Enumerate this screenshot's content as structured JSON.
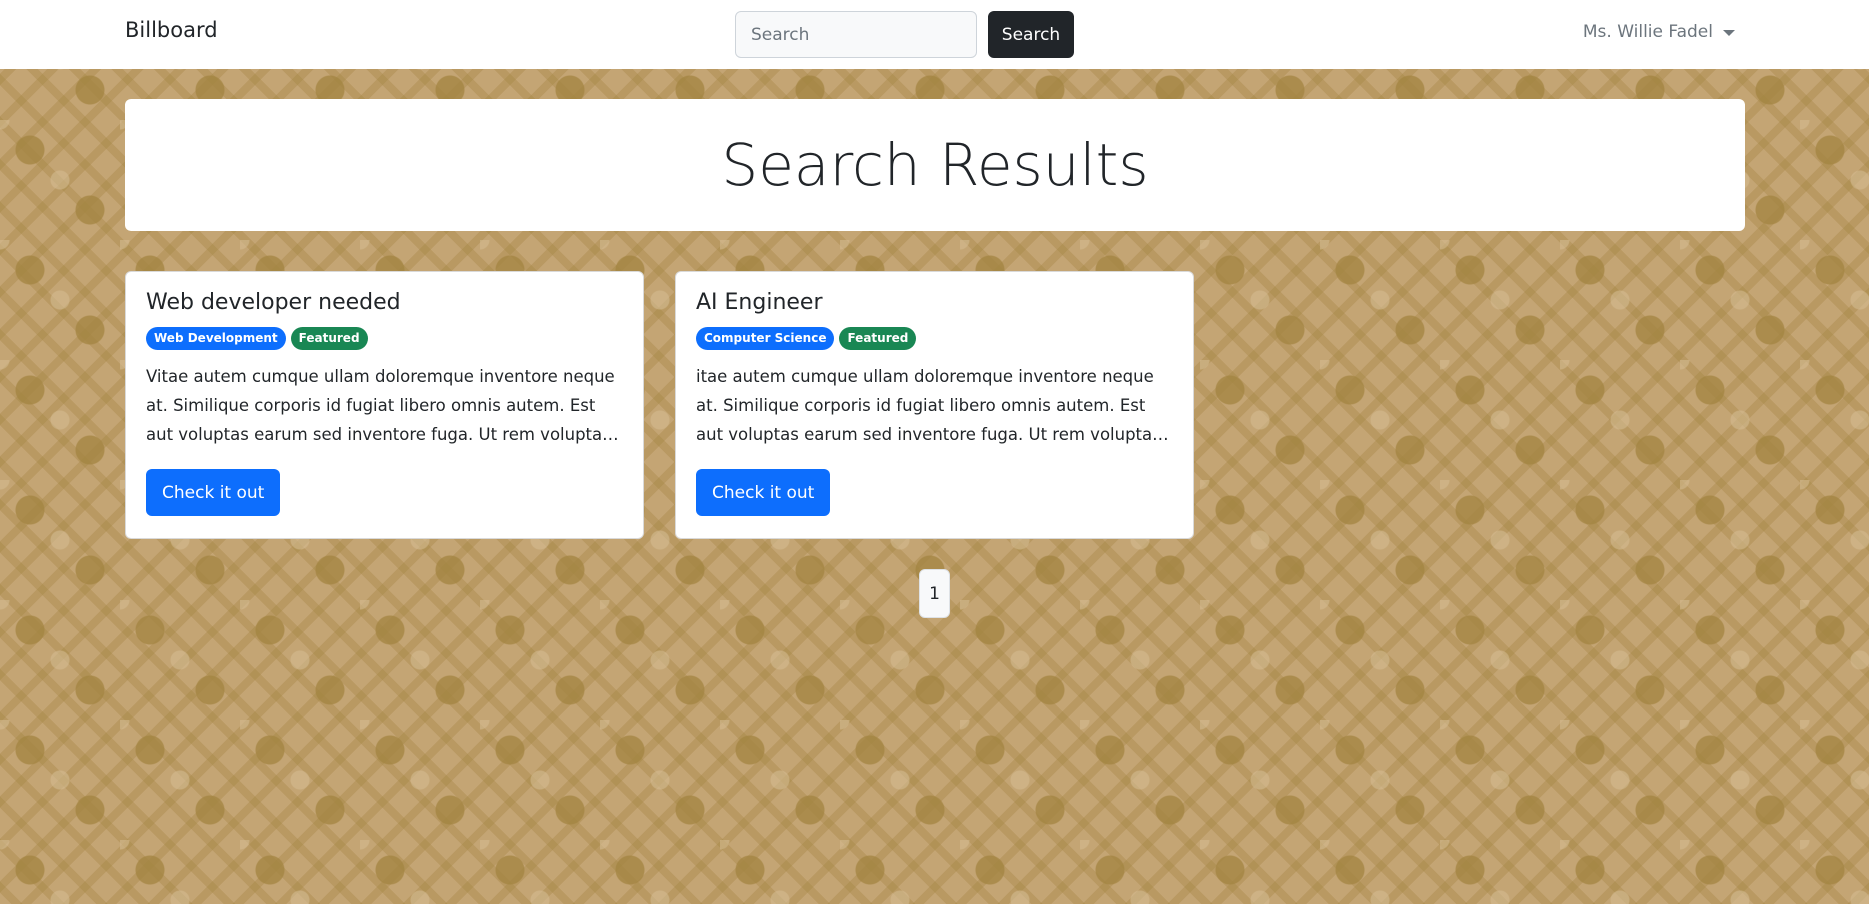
{
  "navbar": {
    "brand": "Billboard",
    "search_placeholder": "Search",
    "search_value": "",
    "search_button": "Search",
    "user_name": "Ms. Willie Fadel"
  },
  "header": {
    "title": "Search Results"
  },
  "cards": [
    {
      "title": "Web developer needed",
      "badges": [
        "Web Development",
        "Featured"
      ],
      "text": "Vitae autem cumque ullam doloremque inventore neque at. Similique corporis id fugiat libero omnis autem. Est aut voluptas earum sed inventore fuga. Ut rem voluptas odit…",
      "button": "Check it out"
    },
    {
      "title": "AI Engineer",
      "badges": [
        "Computer Science",
        "Featured"
      ],
      "text": "itae autem cumque ullam doloremque inventore neque at. Similique corporis id fugiat libero omnis autem. Est aut voluptas earum sed inventore fuga. Ut rem voluptas odit…",
      "button": "Check it out"
    }
  ],
  "pagination": {
    "current_page": "1"
  },
  "colors": {
    "primary": "#0d6efd",
    "success": "#198754",
    "dark": "#212529",
    "background": "#c4a574"
  }
}
